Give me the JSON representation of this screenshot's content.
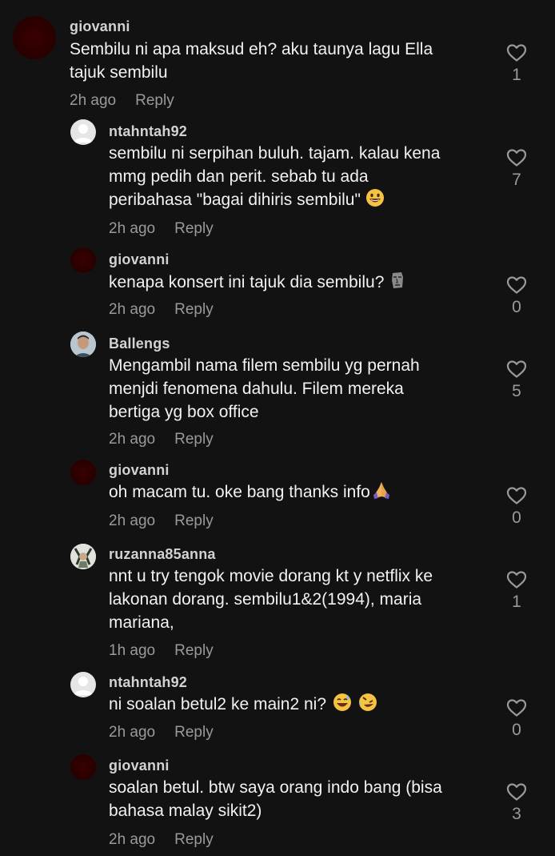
{
  "thread": {
    "comments": [
      {
        "username": "giovanni",
        "text": "Sembilu ni apa maksud eh? aku taunya lagu Ella\ntajuk sembilu",
        "time": "2h ago",
        "reply_label": "Reply",
        "likes": "1"
      },
      {
        "username": "ntahntah92",
        "text": "sembilu ni serpihan buluh. tajam. kalau kena\nmmg pedih dan perit. sebab tu ada\nperibahasa \"bagai dihiris sembilu\"",
        "time": "2h ago",
        "reply_label": "Reply",
        "likes": "7",
        "emoji": "grinning-face-icon"
      },
      {
        "username": "giovanni",
        "text": "kenapa konsert ini tajuk dia sembilu?",
        "time": "2h ago",
        "reply_label": "Reply",
        "likes": "0",
        "emoji": "moai-icon"
      },
      {
        "username": "Ballengs",
        "text": "Mengambil nama filem sembilu yg pernah\nmenjdi fenomena dahulu. Filem mereka\nbertiga yg box office",
        "time": "2h ago",
        "reply_label": "Reply",
        "likes": "5"
      },
      {
        "username": "giovanni",
        "text": "oh macam tu. oke bang thanks info",
        "time": "2h ago",
        "reply_label": "Reply",
        "likes": "0",
        "emoji": "folded-hands-icon"
      },
      {
        "username": "ruzanna85anna",
        "text": "nnt u try tengok movie dorang kt y netflix ke\nlakonan dorang. sembilu1&2(1994), maria\nmariana,",
        "time": "1h ago",
        "reply_label": "Reply",
        "likes": "1"
      },
      {
        "username": "ntahntah92",
        "text": "ni soalan betul2 ke main2 ni?",
        "time": "2h ago",
        "reply_label": "Reply",
        "likes": "0",
        "emoji": "smiling-sweat-icon",
        "emoji2": "rofl-icon"
      },
      {
        "username": "giovanni",
        "text": "soalan betul. btw saya orang indo bang (bisa\nbahasa malay sikit2)",
        "time": "2h ago",
        "reply_label": "Reply",
        "likes": "3"
      }
    ]
  },
  "colors": {
    "background": "#121212",
    "username": "#d2d2d2",
    "text": "#f2f2f2",
    "meta": "#9a9a9a",
    "avatar_dark": "#2a0000"
  }
}
